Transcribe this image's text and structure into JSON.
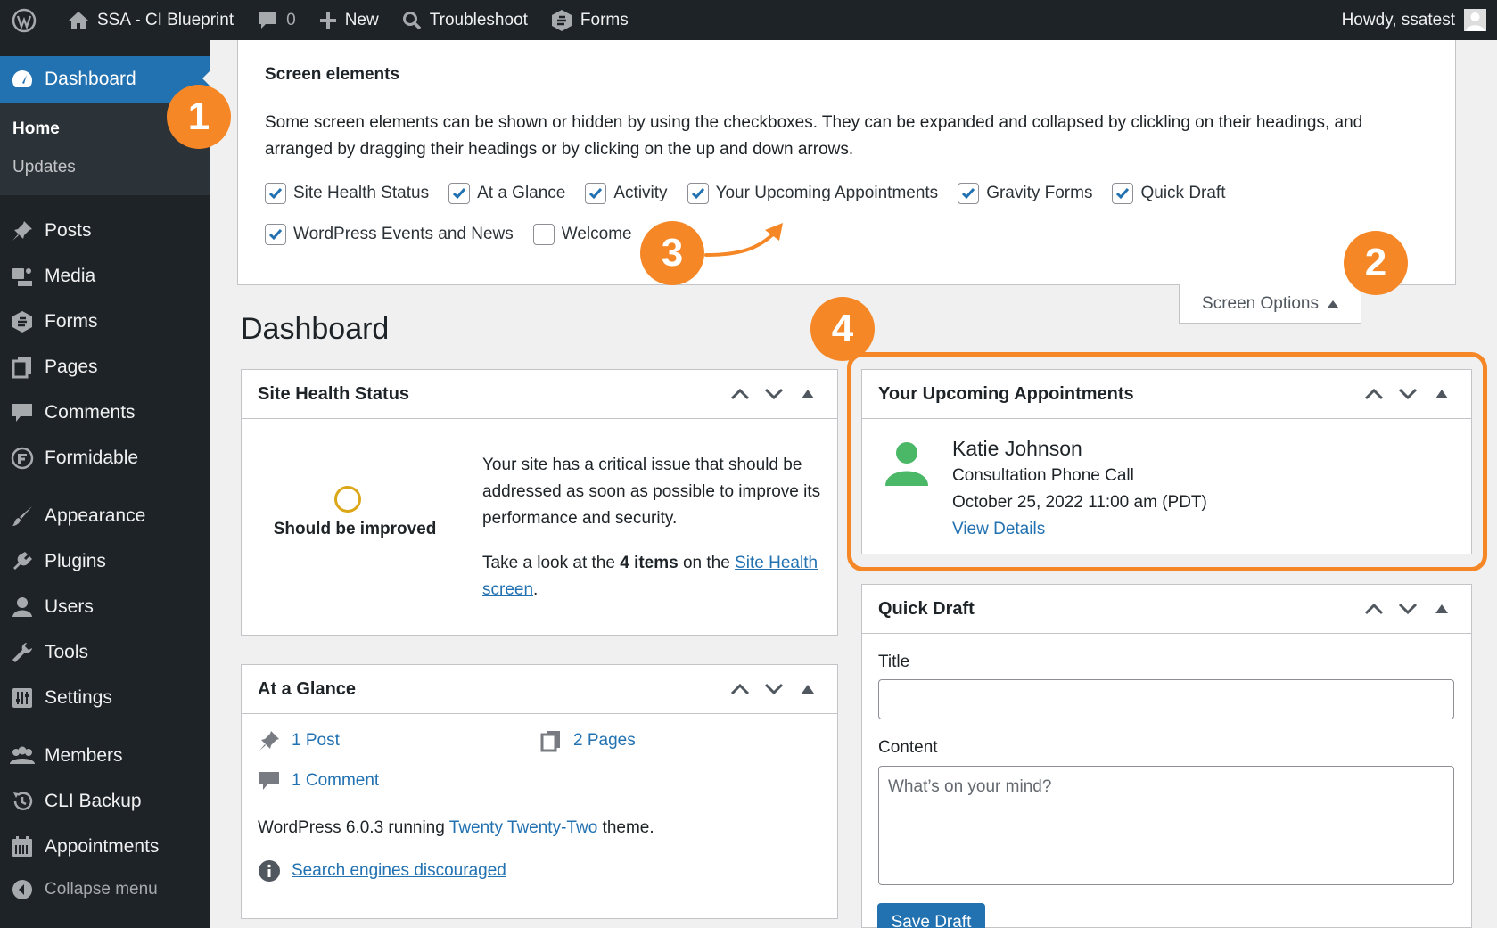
{
  "adminbar": {
    "site_name": "SSA - CI Blueprint",
    "comments_count": "0",
    "new_label": "New",
    "troubleshoot_label": "Troubleshoot",
    "forms_label": "Forms",
    "howdy": "Howdy, ssatest"
  },
  "sidebar": {
    "dashboard": "Dashboard",
    "submenu": [
      "Home",
      "Updates"
    ],
    "items": [
      "Posts",
      "Media",
      "Forms",
      "Pages",
      "Comments",
      "Formidable",
      "Appearance",
      "Plugins",
      "Users",
      "Tools",
      "Settings",
      "Members",
      "CLI Backup",
      "Appointments"
    ],
    "collapse": "Collapse menu"
  },
  "screen_options": {
    "heading": "Screen elements",
    "description": "Some screen elements can be shown or hidden by using the checkboxes. They can be expanded and collapsed by clickling on their headings, and arranged by dragging their headings or by clicking on the up and down arrows.",
    "checkboxes": [
      {
        "label": "Site Health Status",
        "checked": true
      },
      {
        "label": "At a Glance",
        "checked": true
      },
      {
        "label": "Activity",
        "checked": true
      },
      {
        "label": "Your Upcoming Appointments",
        "checked": true
      },
      {
        "label": "Gravity Forms",
        "checked": true
      },
      {
        "label": "Quick Draft",
        "checked": true
      },
      {
        "label": "WordPress Events and News",
        "checked": true
      },
      {
        "label": "Welcome",
        "checked": false
      }
    ],
    "toggle_label": "Screen Options"
  },
  "page_title": "Dashboard",
  "site_health": {
    "title": "Site Health Status",
    "status": "Should be improved",
    "message": "Your site has a critical issue that should be addressed as soon as possible to improve its performance and security.",
    "look_prefix": "Take a look at the ",
    "items_count": "4 items",
    "look_middle": " on the ",
    "link": "Site Health screen",
    "look_suffix": "."
  },
  "at_a_glance": {
    "title": "At a Glance",
    "posts": "1 Post",
    "pages": "2 Pages",
    "comments": "1 Comment",
    "version_prefix": "WordPress 6.0.3 running ",
    "theme": "Twenty Twenty-Two",
    "version_suffix": " theme.",
    "search_engines": "Search engines discouraged"
  },
  "appointments": {
    "title": "Your Upcoming Appointments",
    "name": "Katie Johnson",
    "type": "Consultation Phone Call",
    "datetime": "October 25, 2022 11:00 am (PDT)",
    "link": "View Details"
  },
  "quick_draft": {
    "title": "Quick Draft",
    "title_label": "Title",
    "content_label": "Content",
    "content_placeholder": "What’s on your mind?",
    "save_label": "Save Draft"
  },
  "annotations": [
    "1",
    "2",
    "3",
    "4"
  ],
  "colors": {
    "accent": "#2271b1",
    "annotation": "#f68726",
    "adminbar": "#1d2327",
    "person": "#4ab866"
  }
}
